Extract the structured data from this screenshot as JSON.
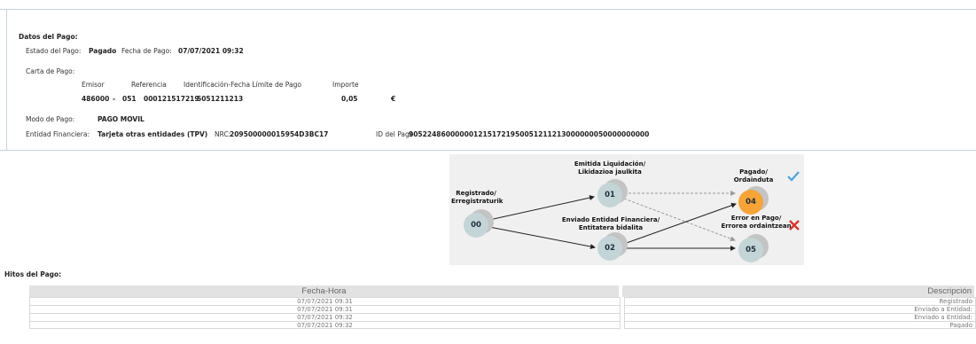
{
  "datos": {
    "title": "Datos del Pago:",
    "estado_label": "Estado del Pago:",
    "estado_value": "Pagado",
    "fecha_label": "Fecha de Pago:",
    "fecha_value": "07/07/2021 09:32",
    "carta_label": "Carta de Pago:",
    "columns": {
      "emisor": "Emisor",
      "referencia": "Referencia",
      "identificacion": "Identificación-Fecha Límite de Pago",
      "importe": "Importe"
    },
    "values": {
      "emisor": "486000",
      "sep": "-",
      "sufijo": "051",
      "referencia": "000121517219",
      "identificacion": "5051211213",
      "importe": "0,05",
      "moneda": "€"
    },
    "modo_label": "Modo de Pago:",
    "modo_value": "PAGO MOVIL",
    "entidad_label": "Entidad Financiera:",
    "entidad_value": "Tarjeta otras entidades (TPV)",
    "nrc_label": "NRC:",
    "nrc_value": "209500000015954D3BC17",
    "id_label": "ID del Pago",
    "id_value": "9052248600000012151721950051211213000000050000000000"
  },
  "diagram": {
    "nodes": {
      "n00": {
        "code": "00",
        "line1": "Registrado/",
        "line2": "Erregistraturik"
      },
      "n01": {
        "code": "01",
        "line1": "Emitida Liquidación/",
        "line2": "Likidazioa jaulkita"
      },
      "n02": {
        "code": "02",
        "line1": "Enviado Entidad Financiera/",
        "line2": "Entitatera bidalita"
      },
      "n04": {
        "code": "04",
        "line1": "Pagado/",
        "line2": "Ordainduta"
      },
      "n05": {
        "code": "05",
        "line1": "Error en Pago/",
        "line2": "Errorea ordaintzean"
      }
    },
    "colors": {
      "active": "#f6a436",
      "node": "#c3d5d7",
      "check": "#4aa3df",
      "cross": "#e0322c"
    }
  },
  "hitos": {
    "title": "Hitos del Pago:",
    "headers": {
      "fecha": "Fecha-Hora",
      "descripcion": "Descripción"
    },
    "rows": [
      {
        "fecha": "07/07/2021 09:31",
        "descripcion": "Registrado"
      },
      {
        "fecha": "07/07/2021 09:31",
        "descripcion": "Enviado a Entidad:"
      },
      {
        "fecha": "07/07/2021 09:32",
        "descripcion": "Enviado a Entidad:"
      },
      {
        "fecha": "07/07/2021 09:32",
        "descripcion": "Pagado"
      }
    ]
  }
}
